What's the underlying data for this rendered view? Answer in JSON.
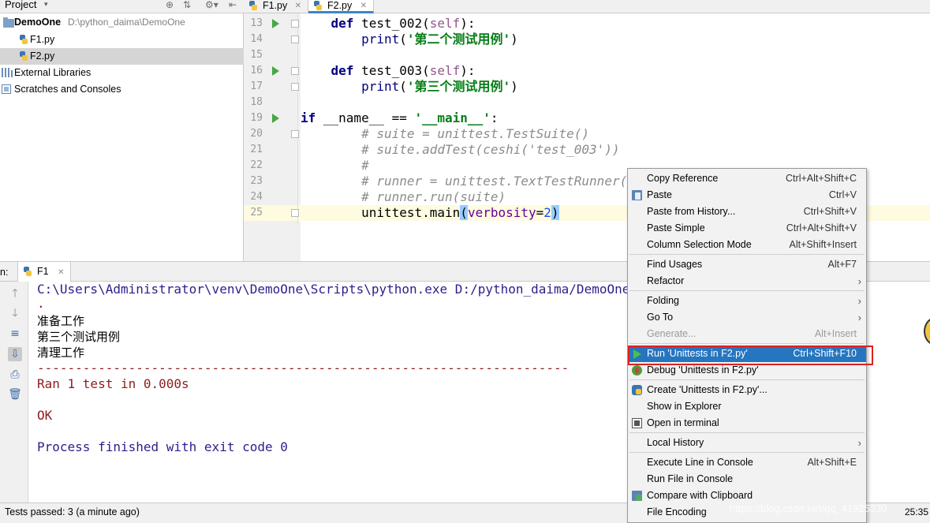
{
  "project": {
    "title": "Project",
    "root": {
      "name": "DemoOne",
      "path": "D:\\python_daima\\DemoOne"
    },
    "files": [
      "F1.py",
      "F2.py"
    ],
    "external_libraries": "External Libraries",
    "scratches": "Scratches and Consoles"
  },
  "editor": {
    "tabs": [
      "F1.py",
      "F2.py"
    ],
    "active_tab": "F2.py",
    "lines": [
      {
        "n": "13",
        "text": "    def test_002(self):"
      },
      {
        "n": "14",
        "text": "        print('第二个测试用例')"
      },
      {
        "n": "15",
        "text": ""
      },
      {
        "n": "16",
        "text": "    def test_003(self):"
      },
      {
        "n": "17",
        "text": "        print('第三个测试用例')"
      },
      {
        "n": "18",
        "text": ""
      },
      {
        "n": "19",
        "text": "if __name__ == '__main__':"
      },
      {
        "n": "20",
        "text": "        # suite = unittest.TestSuite()"
      },
      {
        "n": "21",
        "text": "        # suite.addTest(ceshi('test_003'))"
      },
      {
        "n": "22",
        "text": "        #"
      },
      {
        "n": "23",
        "text": "        # runner = unittest.TextTestRunner()"
      },
      {
        "n": "24",
        "text": "        # runner.run(suite)"
      },
      {
        "n": "25",
        "text": "        unittest.main(verbosity=2)"
      }
    ]
  },
  "run": {
    "label": "n:",
    "tab": "F1",
    "console": {
      "cmd": "C:\\Users\\Administrator\\venv\\DemoOne\\Scripts\\python.exe D:/python_daima/DemoOne/F2.py",
      "dot": ".",
      "out1": "准备工作",
      "out2": "第三个测试用例",
      "out3": "清理工作",
      "dashes": "----------------------------------------------------------------------",
      "ran": "Ran 1 test in 0.000s",
      "ok": "OK",
      "finished": "Process finished with exit code 0"
    }
  },
  "status": {
    "text": "Tests passed: 3 (a minute ago)",
    "time": "25:35",
    "watermark": "https://blog.csdn.net/qq_41925330"
  },
  "context_menu": {
    "items": [
      {
        "label": "Copy Reference",
        "shortcut": "Ctrl+Alt+Shift+C"
      },
      {
        "label": "Paste",
        "shortcut": "Ctrl+V",
        "icon": "paste-icon"
      },
      {
        "label": "Paste from History...",
        "shortcut": "Ctrl+Shift+V"
      },
      {
        "label": "Paste Simple",
        "shortcut": "Ctrl+Alt+Shift+V"
      },
      {
        "label": "Column Selection Mode",
        "shortcut": "Alt+Shift+Insert"
      },
      {
        "label": "Find Usages",
        "shortcut": "Alt+F7"
      },
      {
        "label": "Refactor",
        "submenu": true
      },
      {
        "label": "Folding",
        "submenu": true
      },
      {
        "label": "Go To",
        "submenu": true
      },
      {
        "label": "Generate...",
        "shortcut": "Alt+Insert",
        "disabled": true
      },
      {
        "label": "Run 'Unittests in F2.py'",
        "shortcut": "Ctrl+Shift+F10",
        "highlighted": true,
        "icon": "run-icon"
      },
      {
        "label": "Debug 'Unittests in F2.py'",
        "icon": "debug-icon"
      },
      {
        "label": "Create 'Unittests in F2.py'...",
        "icon": "python-config-icon"
      },
      {
        "label": "Show in Explorer"
      },
      {
        "label": "Open in terminal",
        "icon": "terminal-icon"
      },
      {
        "label": "Local History",
        "submenu": true
      },
      {
        "label": "Execute Line in Console",
        "shortcut": "Alt+Shift+E"
      },
      {
        "label": "Run File in Console"
      },
      {
        "label": "Compare with Clipboard",
        "icon": "compare-icon"
      },
      {
        "label": "File Encoding"
      }
    ]
  }
}
